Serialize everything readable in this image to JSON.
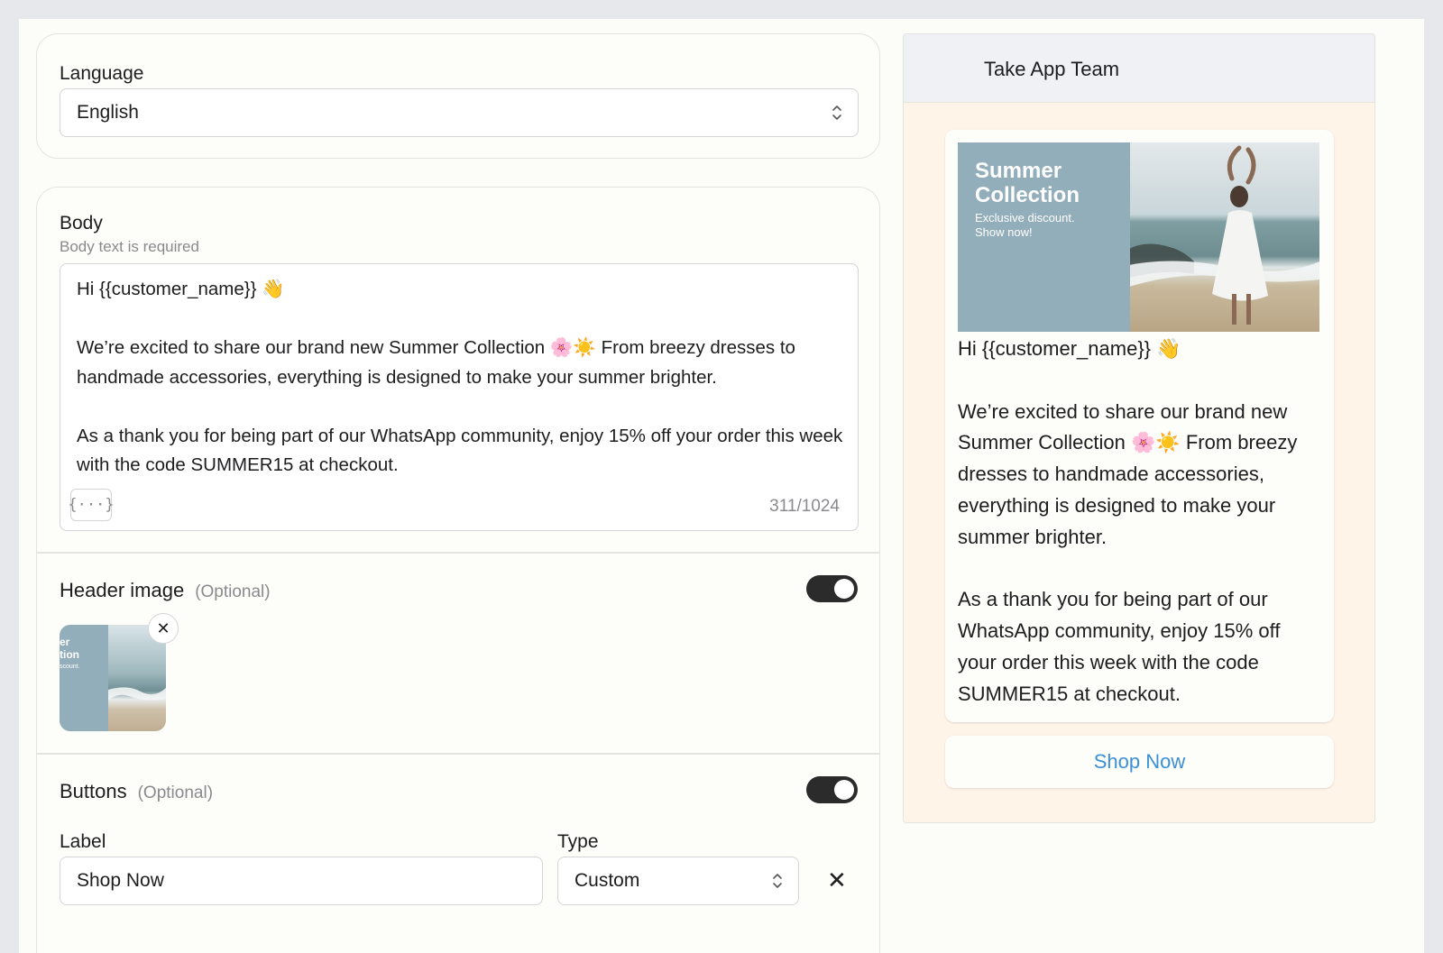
{
  "language": {
    "label": "Language",
    "selected": "English"
  },
  "body": {
    "label": "Body",
    "hint": "Body text is required",
    "text": "Hi {{customer_name}} 👋\n\nWe’re excited to share our brand new Summer Collection 🌸☀️ From breezy dresses to handmade accessories, everything is designed to make your summer brighter.\n\nAs a thank you for being part of our WhatsApp community, enjoy 15% off your order this week with the code SUMMER15 at checkout.",
    "variable_button": "{···}",
    "counter": "311/1024"
  },
  "header_image": {
    "label": "Header image",
    "optional": "(Optional)",
    "enabled": true,
    "close_glyph": "✕",
    "thumb_text": [
      "er",
      "tion",
      "scount."
    ]
  },
  "buttons": {
    "label": "Buttons",
    "optional": "(Optional)",
    "enabled": true,
    "label_field": "Label",
    "type_field": "Type",
    "label_value": "Shop Now",
    "type_value": "Custom",
    "remove_glyph": "✕"
  },
  "preview": {
    "title": "Take App Team",
    "banner": {
      "title": "Summer Collection",
      "subtitle_line1": "Exclusive discount.",
      "subtitle_line2": "Show now!",
      "panel_color": "#93aebb"
    },
    "message": "Hi {{customer_name}} 👋\n\nWe’re excited to share our brand new Summer Collection 🌸☀️ From breezy dresses to handmade accessories, everything is designed to make your summer brighter.\n\nAs a thank you for being part of our WhatsApp community, enjoy 15% off your order this week with the code SUMMER15 at checkout.",
    "cta_label": "Shop Now",
    "cta_color": "#3b8fd6"
  }
}
